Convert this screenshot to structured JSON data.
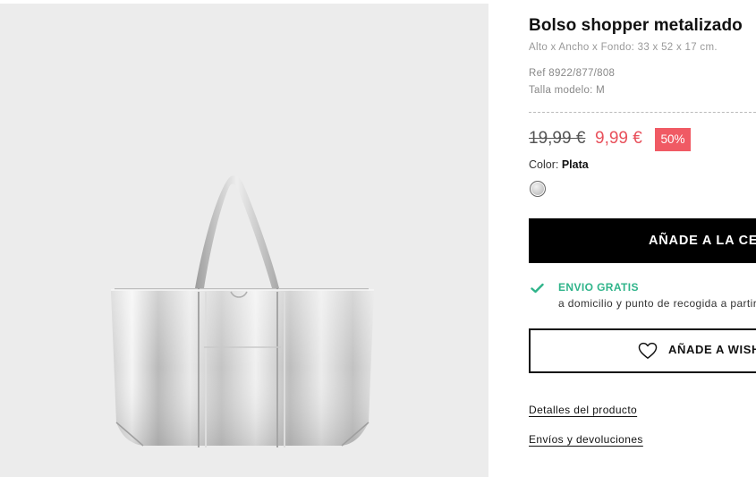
{
  "product": {
    "title": "Bolso shopper metalizado",
    "dimensions": "Alto x Ancho x Fondo: 33 x 52 x 17 cm.",
    "reference": "Ref 8922/877/808",
    "model_size": "Talla modelo: M",
    "image_alt": "silver-metallic-tote-bag"
  },
  "pricing": {
    "old_price": "19,99 €",
    "new_price": "9,99 €",
    "discount": "50%",
    "sale_color": "#e8505b",
    "badge_color": "#f05a64"
  },
  "color": {
    "label": "Color:",
    "selected": "Plata",
    "swatch_color": "#c8c8c8"
  },
  "actions": {
    "add_to_cart": "AÑADE A LA CESTA",
    "add_to_wishlist": "AÑADE A WISHLIST"
  },
  "shipping": {
    "title": "ENVIO GRATIS",
    "description": "a domicilio y punto de recogida a partir de",
    "icon": "check-icon",
    "accent_color": "#2fb48a"
  },
  "links": {
    "details": "Detalles del producto",
    "shipping_returns": "Envíos y devoluciones"
  }
}
